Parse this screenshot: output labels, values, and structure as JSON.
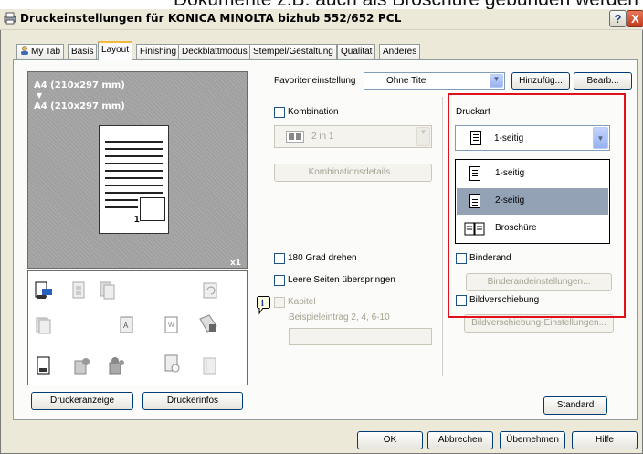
{
  "window": {
    "top_partial_text": "Dokumente z.B. auch als Broschüre gebunden werden soll",
    "title": "Druckeinstellungen für KONICA MINOLTA bizhub 552/652 PCL",
    "help_label": "?",
    "close_label": "X"
  },
  "tabs": [
    {
      "label": "My Tab",
      "active": false
    },
    {
      "label": "Basis",
      "active": false
    },
    {
      "label": "Layout",
      "active": true
    },
    {
      "label": "Finishing",
      "active": false
    },
    {
      "label": "Deckblattmodus",
      "active": false
    },
    {
      "label": "Stempel/Gestaltung",
      "active": false
    },
    {
      "label": "Qualität",
      "active": false
    },
    {
      "label": "Anderes",
      "active": false
    }
  ],
  "preview": {
    "paper_line1": "A4 (210x297 mm)",
    "arrow": "▼",
    "paper_line2": "A4 (210x297 mm)",
    "page_number": "1",
    "copies": "x1"
  },
  "buttons": {
    "druckeranzeige": "Druckeranzeige",
    "druckerinfos": "Druckerinfos",
    "hinzufueg": "Hinzufüg...",
    "bearb": "Bearb...",
    "kombinationsdetails": "Kombinationsdetails...",
    "binderandeinstellungen": "Binderandeinstellungen...",
    "bildverschiebung_einstellungen": "Bildverschiebung-Einstellungen...",
    "standard": "Standard",
    "ok": "OK",
    "abbrechen": "Abbrechen",
    "uebernehmen": "Übernehmen",
    "hilfe": "Hilfe"
  },
  "favorites": {
    "label": "Favoriteneinstellung",
    "value": "Ohne Titel"
  },
  "kombination": {
    "label": "Kombination",
    "value": "2 in 1"
  },
  "druckart": {
    "label": "Druckart",
    "value": "1-seitig",
    "options": [
      "1-seitig",
      "2-seitig",
      "Broschüre"
    ],
    "highlighted": "2-seitig"
  },
  "checkboxes": {
    "rotate": "180 Grad drehen",
    "skip_blank": "Leere Seiten überspringen",
    "kapitel": "Kapitel",
    "binderand": "Binderand",
    "bildverschiebung": "Bildverschiebung"
  },
  "kapitel_hint": "Beispieleintrag 2, 4, 6-10",
  "info_icon": "i"
}
